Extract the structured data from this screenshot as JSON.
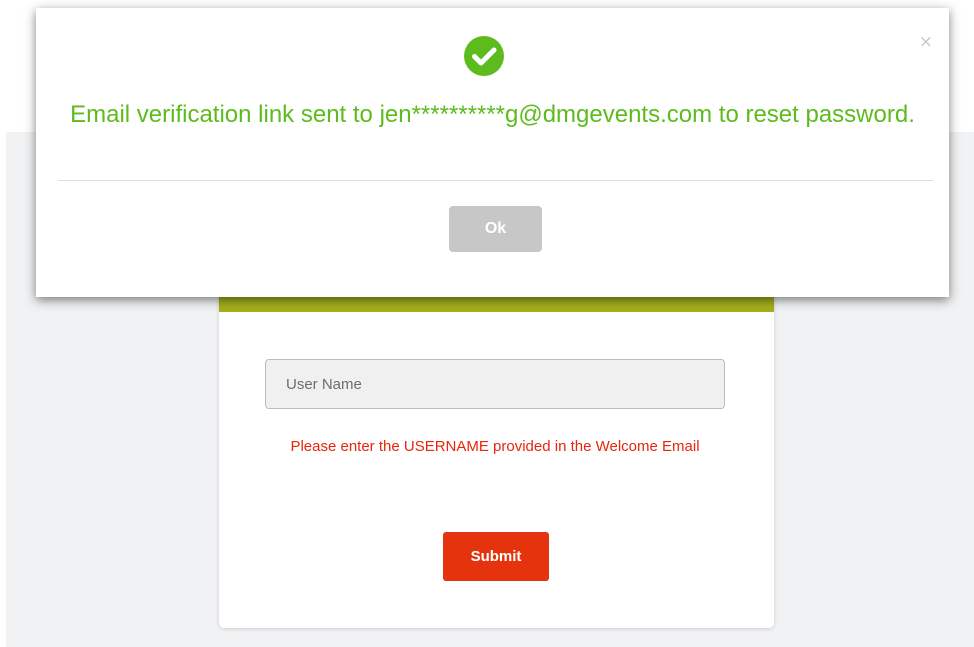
{
  "login": {
    "username_placeholder": "User Name",
    "username_value": "",
    "hint": "Please enter the USERNAME provided in the Welcome Email",
    "submit_label": "Submit"
  },
  "alert": {
    "close_glyph": "×",
    "icon": "check-circle-icon",
    "message": "Email verification link sent to jen**********g@dmgevents.com to reset password.",
    "ok_label": "Ok"
  },
  "colors": {
    "success": "#5dbb1e",
    "error_text": "#e8260c",
    "submit_bg": "#e5330e",
    "ok_bg": "#c7c7c7",
    "card_accent": "#a5b01c"
  }
}
